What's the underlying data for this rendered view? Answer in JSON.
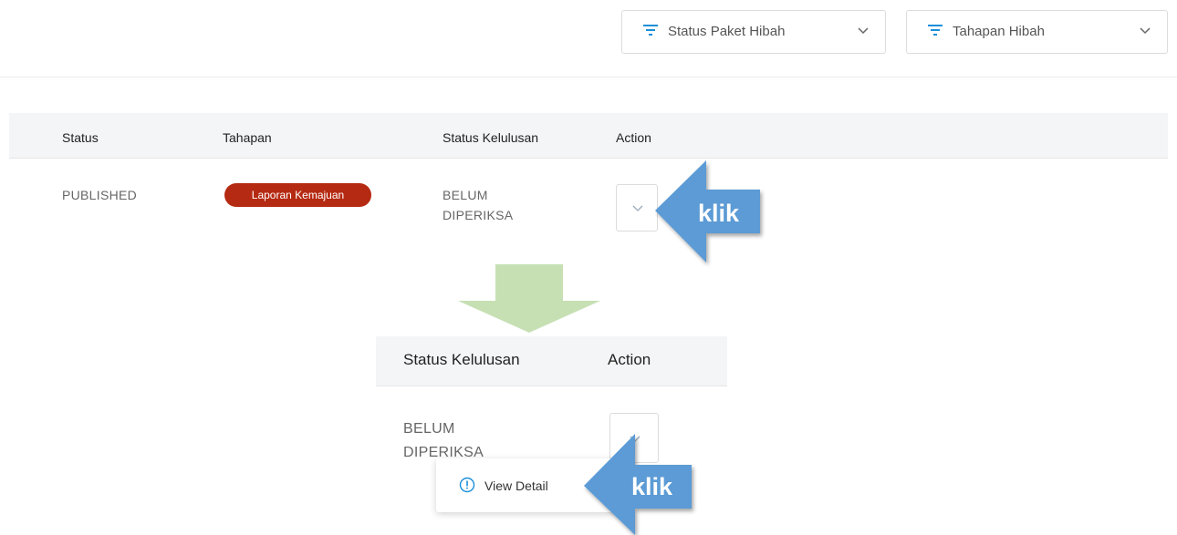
{
  "filters": {
    "status_paket": {
      "label": "Status Paket Hibah",
      "icon": "filter-icon"
    },
    "tahapan": {
      "label": "Tahapan Hibah",
      "icon": "filter-icon"
    }
  },
  "table": {
    "headers": {
      "status": "Status",
      "tahapan": "Tahapan",
      "status_kelulusan": "Status Kelulusan",
      "action": "Action"
    },
    "row": {
      "status": "PUBLISHED",
      "tahapan_badge": "Laporan Kemajuan",
      "status_kelulusan_line1": "BELUM",
      "status_kelulusan_line2": "DIPERIKSA"
    }
  },
  "zoom": {
    "headers": {
      "status_kelulusan": "Status Kelulusan",
      "action": "Action"
    },
    "row": {
      "status_kelulusan_line1": "BELUM",
      "status_kelulusan_line2": "DIPERIKSA"
    },
    "menu": {
      "view_detail": "View Detail",
      "icon": "info-icon"
    }
  },
  "annotations": {
    "klik_top": "klik",
    "klik_bottom": "klik"
  },
  "colors": {
    "badge": "#b52a12",
    "filter_icon": "#1a8fd8",
    "arrow_blue": "#5b9bd5",
    "arrow_green": "#c6e0b4"
  }
}
